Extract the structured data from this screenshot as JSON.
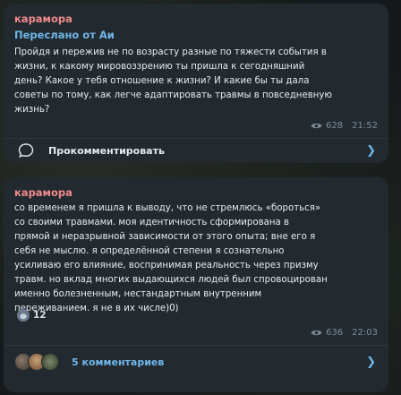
{
  "post1": {
    "author": "карамора",
    "forwarded_label": "Переслано от Аи",
    "text_lines": [
      "Пройдя и пережив не по возрасту разные по тяжести события в",
      "жизни, к какому мировоззрению ты пришла к сегодняшний",
      "день? Какое у тебя отношение к жизни? И какие бы ты дала",
      "советы по тому, как легче адаптировать травмы в повседневную",
      "жизнь?"
    ],
    "views": "628",
    "time": "21:52",
    "comment_label": "Прокомментировать"
  },
  "post2": {
    "author": "карамора",
    "text_lines": [
      "со временем я пришла к выводу, что не стремлюсь «бороться»",
      "со своими травмами. моя идентичность сформирована в",
      "прямой и неразрывной зависимости от этого опыта; вне его я",
      "себя не мыслю. я определённой степени я сознательно",
      "усиливаю его влияние, воспринимая реальность через призму",
      "травм. но вклад многих выдающихся людей был спровоцирован",
      "именно болезненным, нестандартным внутренним",
      "переживанием. я не в их числе)0)"
    ],
    "reaction_count": "12",
    "views": "636",
    "time": "22:03",
    "comment_label": "5 комментариев"
  },
  "colors": {
    "author": "#f08a8a",
    "link": "#6fb7ea",
    "bubble": "#222a30"
  }
}
